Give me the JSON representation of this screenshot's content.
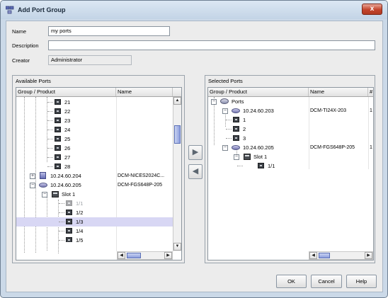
{
  "window": {
    "title": "Add Port Group",
    "close_label": "x"
  },
  "form": {
    "name_label": "Name",
    "name_value": "my ports",
    "description_label": "Description",
    "description_value": "",
    "creator_label": "Creator",
    "creator_value": "Administrator"
  },
  "available": {
    "title": "Available Ports",
    "columns": [
      "Group / Product",
      "Name"
    ],
    "rows": [
      {
        "label": "21",
        "name": ""
      },
      {
        "label": "22",
        "name": ""
      },
      {
        "label": "23",
        "name": ""
      },
      {
        "label": "24",
        "name": ""
      },
      {
        "label": "25",
        "name": ""
      },
      {
        "label": "26",
        "name": ""
      },
      {
        "label": "27",
        "name": ""
      },
      {
        "label": "28",
        "name": ""
      },
      {
        "label": "10.24.60.204",
        "name": "DCM-NICES2024C..."
      },
      {
        "label": "10.24.60.205",
        "name": "DCM-FGS648P-205"
      },
      {
        "label": "Slot 1",
        "name": ""
      },
      {
        "label": "1/1",
        "name": ""
      },
      {
        "label": "1/2",
        "name": ""
      },
      {
        "label": "1/3",
        "name": ""
      },
      {
        "label": "1/4",
        "name": ""
      },
      {
        "label": "1/5",
        "name": ""
      }
    ]
  },
  "selected": {
    "title": "Selected Ports",
    "columns": [
      "Group / Product",
      "Name",
      "#"
    ],
    "rows": [
      {
        "label": "Ports",
        "name": "",
        "extra": ""
      },
      {
        "label": "10.24.60.203",
        "name": "DCM-TI24X-203",
        "extra": "1"
      },
      {
        "label": "1",
        "name": "",
        "extra": ""
      },
      {
        "label": "2",
        "name": "",
        "extra": ""
      },
      {
        "label": "3",
        "name": "",
        "extra": ""
      },
      {
        "label": "10.24.60.205",
        "name": "DCM-FGS648P-205",
        "extra": "1"
      },
      {
        "label": "Slot 1",
        "name": "",
        "extra": ""
      },
      {
        "label": "1/1",
        "name": "",
        "extra": ""
      }
    ]
  },
  "transfer": {
    "add_symbol": "▶",
    "remove_symbol": "◀"
  },
  "buttons": {
    "ok": "OK",
    "cancel": "Cancel",
    "help": "Help"
  },
  "scroll": {
    "up": "▲",
    "down": "▼",
    "left": "◀",
    "right": "▶"
  }
}
